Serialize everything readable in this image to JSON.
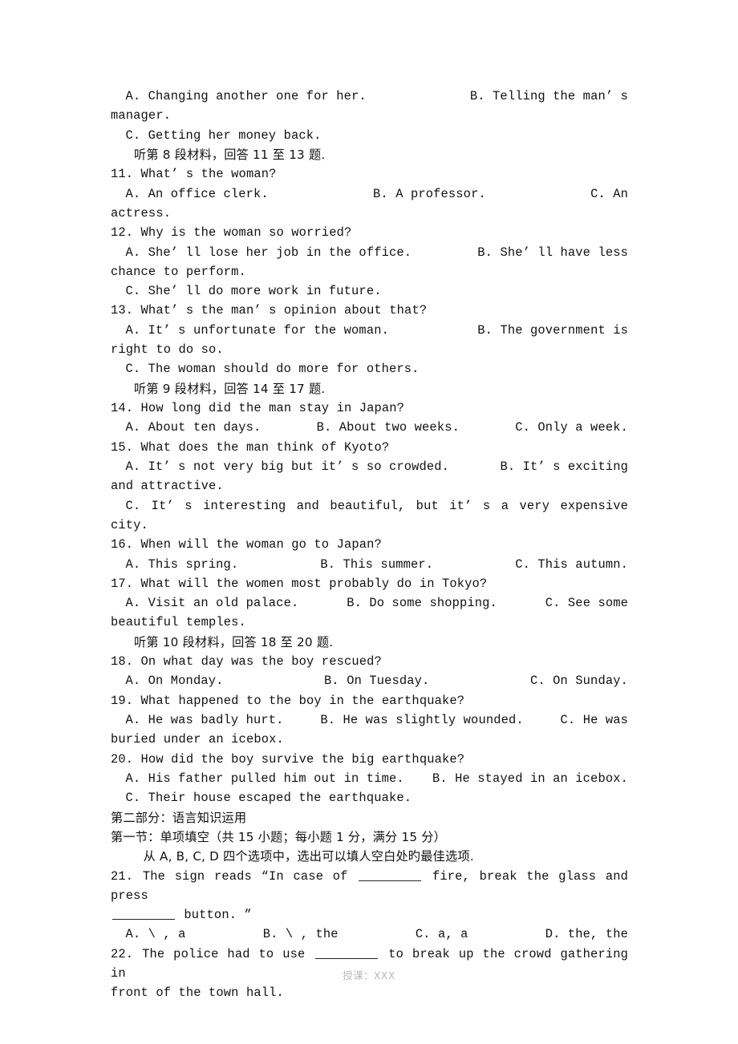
{
  "document": {
    "footer_note": "授课：XXX"
  },
  "lines": [
    {
      "id": "q10_opt_ab",
      "kind": "opts3",
      "indent": 2,
      "a": "A. Changing another one for her.",
      "b": "B. Telling the man’ s",
      "c": ""
    },
    {
      "id": "q10_opt_ab_wrap",
      "kind": "text",
      "indent": 0,
      "text": "manager."
    },
    {
      "id": "q10_opt_c",
      "kind": "text",
      "indent": 2,
      "text": "C. Getting her money back."
    },
    {
      "id": "dir_8",
      "kind": "cn",
      "indent": 3,
      "text": "听第 8 段材料，回答 11 至 13 题."
    },
    {
      "id": "q11_stem",
      "kind": "text",
      "indent": 0,
      "text": "11. What’ s the woman?"
    },
    {
      "id": "q11_opts",
      "kind": "opts3",
      "indent": 2,
      "a": "A. An office clerk.",
      "b": "B. A professor.",
      "c": "C. An"
    },
    {
      "id": "q11_opts_wrap",
      "kind": "text",
      "indent": 0,
      "text": "actress."
    },
    {
      "id": "q12_stem",
      "kind": "text",
      "indent": 0,
      "text": "12. Why is the woman so worried?"
    },
    {
      "id": "q12_opt_ab",
      "kind": "opts3",
      "indent": 2,
      "a": "A. She’ ll lose her job in the office.",
      "b": "B. She’ ll have less",
      "c": ""
    },
    {
      "id": "q12_opt_ab_wrap",
      "kind": "text",
      "indent": 0,
      "text": "chance to perform."
    },
    {
      "id": "q12_opt_c",
      "kind": "text",
      "indent": 2,
      "text": "C. She’ ll do more work in future."
    },
    {
      "id": "q13_stem",
      "kind": "text",
      "indent": 0,
      "text": "13. What’ s the man’ s opinion about that?"
    },
    {
      "id": "q13_opt_ab",
      "kind": "opts3",
      "indent": 2,
      "a": "A. It’ s unfortunate for the woman.",
      "b": "B. The government is",
      "c": ""
    },
    {
      "id": "q13_opt_ab_wrap",
      "kind": "text",
      "indent": 0,
      "text": "right to do so."
    },
    {
      "id": "q13_opt_c",
      "kind": "text",
      "indent": 2,
      "text": "C. The woman should do more for others."
    },
    {
      "id": "dir_9",
      "kind": "cn",
      "indent": 3,
      "text": "听第 9 段材料，回答 14 至 17 题."
    },
    {
      "id": "q14_stem",
      "kind": "text",
      "indent": 0,
      "text": "14. How long did the man stay in Japan?"
    },
    {
      "id": "q14_opts",
      "kind": "opts3",
      "indent": 2,
      "a": "A. About ten days.",
      "b": "B. About two weeks.",
      "c": "C. Only a week."
    },
    {
      "id": "q15_stem",
      "kind": "text",
      "indent": 0,
      "text": "15. What does the man think of Kyoto?"
    },
    {
      "id": "q15_opt_ab",
      "kind": "opts3",
      "indent": 2,
      "a": "A. It’ s not very big but it’ s so crowded.",
      "b": "B. It’ s exciting",
      "c": ""
    },
    {
      "id": "q15_opt_ab_wrap",
      "kind": "text",
      "indent": 0,
      "text": "and attractive."
    },
    {
      "id": "q15_opt_c",
      "kind": "text",
      "indent": 2,
      "text": "C. It’ s interesting and beautiful, but it’ s a very expensive city."
    },
    {
      "id": "q16_stem",
      "kind": "text",
      "indent": 0,
      "text": "16. When will the woman go to Japan?"
    },
    {
      "id": "q16_opts",
      "kind": "opts3",
      "indent": 2,
      "a": "A. This spring.",
      "b": "B. This summer.",
      "c": "C. This autumn."
    },
    {
      "id": "q17_stem",
      "kind": "text",
      "indent": 0,
      "text": "17. What will the women most probably do in Tokyo?"
    },
    {
      "id": "q17_opts",
      "kind": "opts3",
      "indent": 2,
      "a": "A. Visit an old palace.",
      "b": "B. Do some shopping.",
      "c": "C. See some"
    },
    {
      "id": "q17_opts_wrap",
      "kind": "text",
      "indent": 0,
      "text": "beautiful temples."
    },
    {
      "id": "dir_10",
      "kind": "cn",
      "indent": 3,
      "text": "听第 10 段材料，回答 18 至 20 题."
    },
    {
      "id": "q18_stem",
      "kind": "text",
      "indent": 0,
      "text": "18. On what day was the boy rescued?"
    },
    {
      "id": "q18_opts",
      "kind": "opts3",
      "indent": 2,
      "a": "A. On Monday.",
      "b": "B. On Tuesday.",
      "c": "C. On Sunday."
    },
    {
      "id": "q19_stem",
      "kind": "text",
      "indent": 0,
      "text": "19. What happened to the boy in the earthquake?"
    },
    {
      "id": "q19_opts",
      "kind": "opts3",
      "indent": 2,
      "a": "A. He was badly hurt.",
      "b": "B. He was slightly wounded.",
      "c": "C. He was"
    },
    {
      "id": "q19_opts_wrap",
      "kind": "text",
      "indent": 0,
      "text": "buried under an icebox."
    },
    {
      "id": "q20_stem",
      "kind": "text",
      "indent": 0,
      "text": "20. How did the boy survive the big earthquake?"
    },
    {
      "id": "q20_opt_ab",
      "kind": "opts3",
      "indent": 2,
      "a": "A. His father pulled him out in time.",
      "b": "B. He stayed in an icebox.",
      "c": ""
    },
    {
      "id": "q20_opt_c",
      "kind": "text",
      "indent": 2,
      "text": "C. Their house escaped the earthquake."
    },
    {
      "id": "part2_head",
      "kind": "cn",
      "indent": 0,
      "text": "第二部分：语言知识运用"
    },
    {
      "id": "section1_head",
      "kind": "cn",
      "indent": 0,
      "text": "第一节：单项填空（共 15 小题；每小题 1 分，满分 15 分）"
    },
    {
      "id": "section1_instr",
      "kind": "cn",
      "indent": 4,
      "text": "从 A, B, C, D 四个选项中，选出可以填人空白处旳最佳选项."
    },
    {
      "id": "q21_stem",
      "kind": "blankline",
      "indent": 0,
      "parts": [
        "21. The sign reads “In case of ",
        "BLANK",
        " fire, break the glass and press"
      ]
    },
    {
      "id": "q21_stem_wrap",
      "kind": "blankline",
      "indent": 0,
      "parts": [
        "BLANK",
        " button. ”"
      ]
    },
    {
      "id": "q21_opts",
      "kind": "opts4",
      "indent": 2,
      "a": "A. \\ , a",
      "b": "B. \\ , the",
      "c": "C. a, a",
      "d": "D. the, the"
    },
    {
      "id": "q22_stem",
      "kind": "blankline",
      "indent": 0,
      "parts": [
        "22. The police had to use ",
        "BLANK",
        " to break up the crowd gathering in"
      ]
    },
    {
      "id": "q22_stem_wrap",
      "kind": "text",
      "indent": 0,
      "text": "front of the town hall."
    }
  ]
}
